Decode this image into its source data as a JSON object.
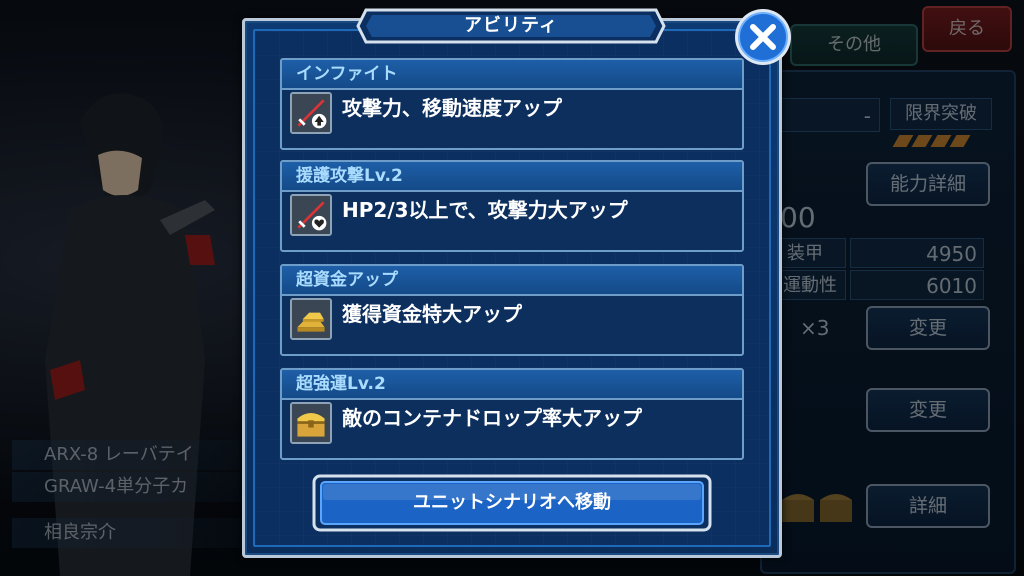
{
  "background": {
    "tab_other": "その他",
    "back_button": "戻る",
    "limit_break_label": "限界突破",
    "dash_value": "-",
    "ability_detail_button": "能力詳細",
    "partial_value": "00",
    "armor_label": "装甲",
    "armor_value": "4950",
    "mobility_label": "運動性",
    "mobility_value": "6010",
    "multiplier": "×3",
    "change_button_1": "変更",
    "change_button_2": "変更",
    "detail_button": "詳細",
    "unit_name": "ARX-8 レーバテイ",
    "weapon_name": "GRAW-4単分子カ",
    "pilot_name": "相良宗介"
  },
  "modal": {
    "title": "アビリティ",
    "abilities": [
      {
        "name": "インファイト",
        "description": "攻撃力、移動速度アップ",
        "icon": "sword-up-icon"
      },
      {
        "name": "援護攻撃Lv.2",
        "description": "HP2/3以上で、攻撃力大アップ",
        "icon": "sword-heart-icon"
      },
      {
        "name": "超資金アップ",
        "description": "獲得資金特大アップ",
        "icon": "gold-bars-icon"
      },
      {
        "name": "超強運Lv.2",
        "description": "敵のコンテナドロップ率大アップ",
        "icon": "treasure-chest-icon"
      }
    ],
    "move_button": "ユニットシナリオへ移動",
    "close_icon": "close-icon"
  },
  "colors": {
    "modal_bg": "#0b2f60",
    "header_bg": "#1e5fa8",
    "ability_name_text": "#a9dcff",
    "close_button": "#1f6fd6"
  }
}
